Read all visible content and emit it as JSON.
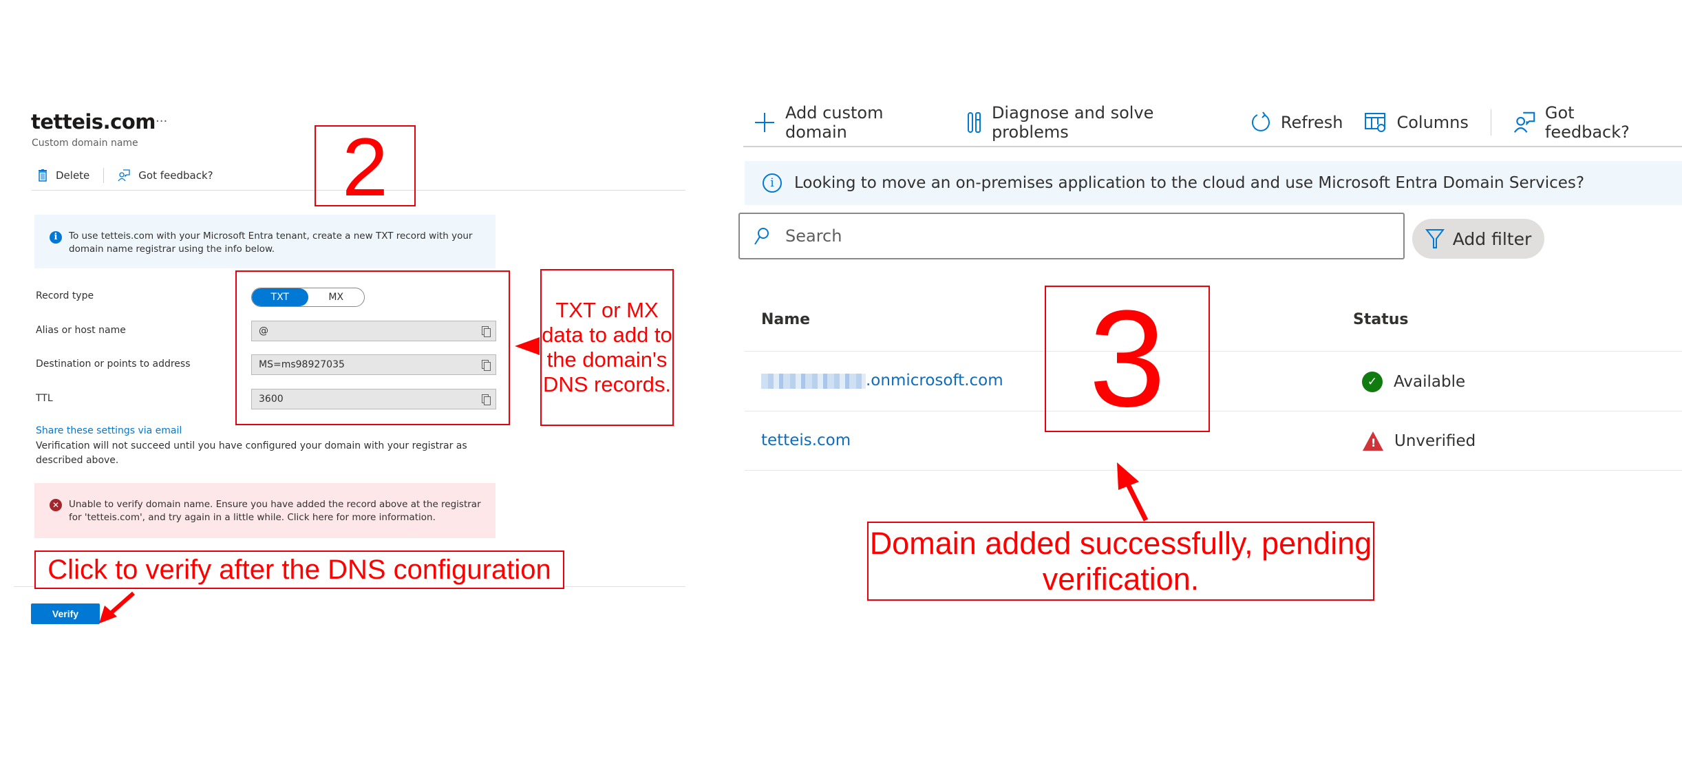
{
  "left_panel": {
    "title": "tetteis.com",
    "more_label": "···",
    "subtitle": "Custom domain name",
    "toolbar": {
      "delete_label": "Delete",
      "feedback_label": "Got feedback?"
    },
    "info_message": "To use tetteis.com with your Microsoft Entra tenant, create a new TXT record with your domain name registrar using the info below.",
    "fields": {
      "record_type_label": "Record type",
      "record_type_options": [
        "TXT",
        "MX"
      ],
      "record_type_selected": "TXT",
      "alias_label": "Alias or host name",
      "alias_value": "@",
      "destination_label": "Destination or points to address",
      "destination_value": "MS=ms98927035",
      "ttl_label": "TTL",
      "ttl_value": "3600"
    },
    "share_link": "Share these settings via email",
    "verification_note": "Verification will not succeed until you have configured your domain with your registrar as described above.",
    "error_message": "Unable to verify domain name. Ensure you have added the record above at the registrar for 'tetteis.com', and try again in a little while. Click here for more information.",
    "verify_button": "Verify"
  },
  "right_panel": {
    "toolbar": {
      "add_custom_domain": "Add custom domain",
      "diagnose": "Diagnose and solve problems",
      "refresh": "Refresh",
      "columns": "Columns",
      "feedback": "Got feedback?"
    },
    "info_message": "Looking to move an on-premises application to the cloud and use Microsoft Entra Domain Services?",
    "search": {
      "placeholder": "Search",
      "value": ""
    },
    "add_filter_label": "Add filter",
    "table": {
      "columns": [
        "Name",
        "Status"
      ],
      "rows": [
        {
          "name_suffix": ".onmicrosoft.com",
          "name_redacted": true,
          "status": "Available",
          "status_type": "success"
        },
        {
          "name": "tetteis.com",
          "status": "Unverified",
          "status_type": "warning"
        }
      ]
    }
  },
  "annotations": {
    "step2": "2",
    "step3": "3",
    "dns_note": "TXT or MX data to add to the domain's DNS records.",
    "verify_note": "Click to verify after the DNS configuration",
    "domain_note": "Domain added successfully, pending verification."
  },
  "colors": {
    "accent": "#0078d4",
    "annotation": "#ff0000",
    "success": "#107c10",
    "warning": "#d13438",
    "error": "#a4262c"
  }
}
